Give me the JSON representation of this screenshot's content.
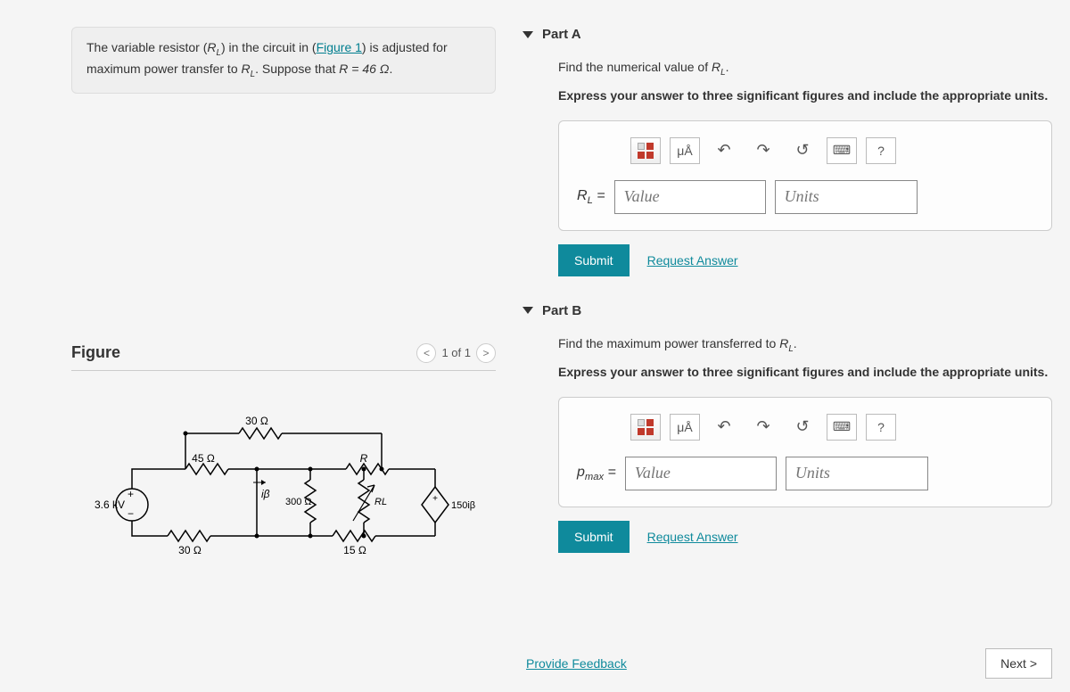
{
  "problem": {
    "text_before_link": "The variable resistor (",
    "rl": "R",
    "rl_sub": "L",
    "text_mid1": ") in the circuit in (",
    "link": "Figure 1",
    "text_mid2": ") is adjusted for maximum power transfer to ",
    "text_after": ". Suppose that ",
    "eq": "R = 46 Ω",
    "period": "."
  },
  "figure": {
    "title": "Figure",
    "page": "1 of 1",
    "labels": {
      "r30a": "30 Ω",
      "r45": "45 Ω",
      "r_var": "R",
      "v_src": "3.6 kV",
      "ibeta": "iβ",
      "r300": "300 Ω",
      "rl": "RL",
      "i150": "150iβ",
      "r30b": "30 Ω",
      "r15": "15 Ω"
    }
  },
  "partA": {
    "title": "Part A",
    "prompt_pre": "Find the numerical value of ",
    "prompt_var": "R",
    "prompt_sub": "L",
    "instruction": "Express your answer to three significant figures and include the appropriate units.",
    "var_label_pre": "R",
    "var_label_sub": "L",
    "equals": " = ",
    "value_placeholder": "Value",
    "units_placeholder": "Units",
    "submit": "Submit",
    "request": "Request Answer",
    "mu": "μÅ",
    "help": "?"
  },
  "partB": {
    "title": "Part B",
    "prompt_pre": "Find the maximum power transferred to ",
    "prompt_var": "R",
    "prompt_sub": "L",
    "instruction": "Express your answer to three significant figures and include the appropriate units.",
    "var_label": "p",
    "var_label_sub": "max",
    "equals": " = ",
    "value_placeholder": "Value",
    "units_placeholder": "Units",
    "submit": "Submit",
    "request": "Request Answer",
    "mu": "μÅ",
    "help": "?"
  },
  "footer": {
    "feedback": "Provide Feedback",
    "next": "Next >"
  }
}
